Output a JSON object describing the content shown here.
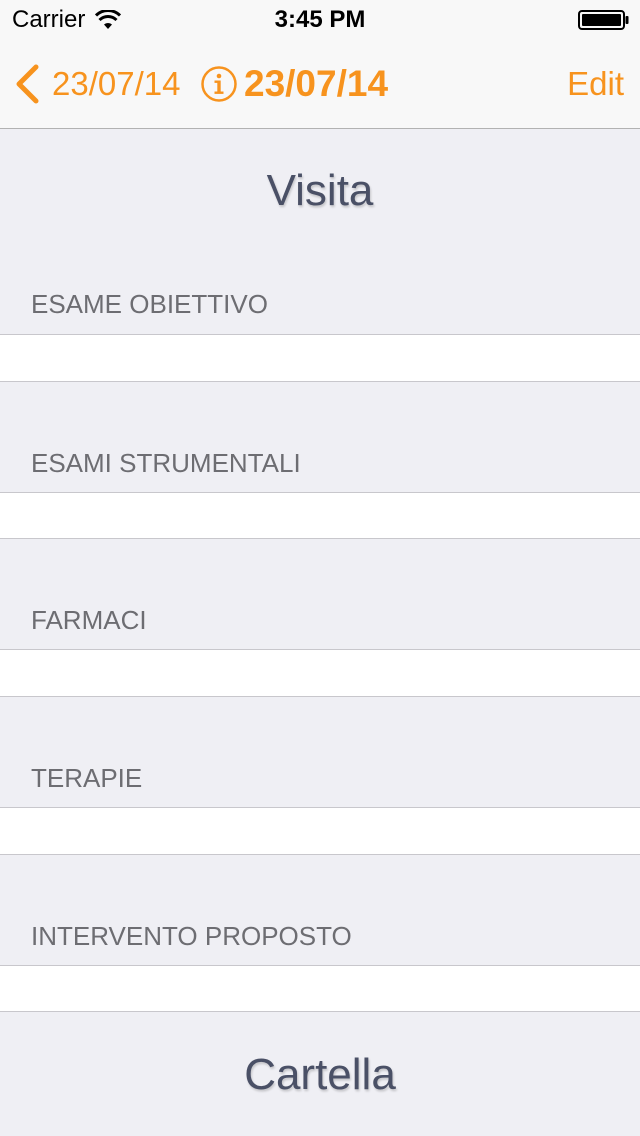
{
  "status_bar": {
    "carrier": "Carrier",
    "time": "3:45 PM"
  },
  "nav": {
    "back_label": "23/07/14",
    "title": "23/07/14",
    "edit_label": "Edit",
    "accent_color": "#f7931e"
  },
  "main": {
    "title": "Visita",
    "sections": [
      {
        "header": "ESAME OBIETTIVO"
      },
      {
        "header": "ESAMI STRUMENTALI"
      },
      {
        "header": "FARMACI"
      },
      {
        "header": "TERAPIE"
      },
      {
        "header": "INTERVENTO PROPOSTO"
      }
    ],
    "footer_title": "Cartella"
  }
}
